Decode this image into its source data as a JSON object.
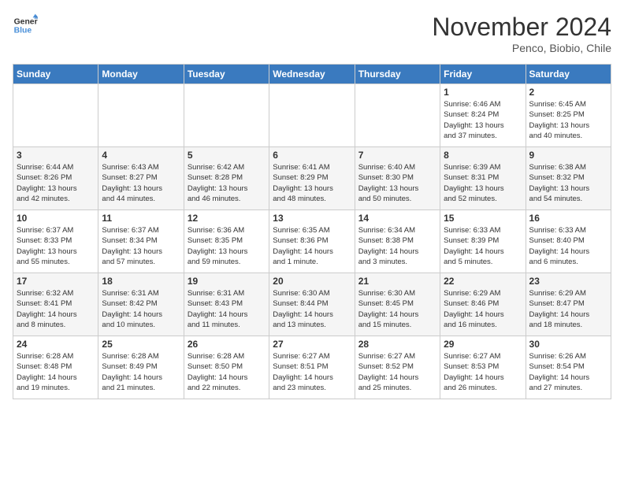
{
  "logo": {
    "line1": "General",
    "line2": "Blue"
  },
  "title": "November 2024",
  "subtitle": "Penco, Biobio, Chile",
  "days_of_week": [
    "Sunday",
    "Monday",
    "Tuesday",
    "Wednesday",
    "Thursday",
    "Friday",
    "Saturday"
  ],
  "weeks": [
    [
      {
        "day": "",
        "info": ""
      },
      {
        "day": "",
        "info": ""
      },
      {
        "day": "",
        "info": ""
      },
      {
        "day": "",
        "info": ""
      },
      {
        "day": "",
        "info": ""
      },
      {
        "day": "1",
        "info": "Sunrise: 6:46 AM\nSunset: 8:24 PM\nDaylight: 13 hours\nand 37 minutes."
      },
      {
        "day": "2",
        "info": "Sunrise: 6:45 AM\nSunset: 8:25 PM\nDaylight: 13 hours\nand 40 minutes."
      }
    ],
    [
      {
        "day": "3",
        "info": "Sunrise: 6:44 AM\nSunset: 8:26 PM\nDaylight: 13 hours\nand 42 minutes."
      },
      {
        "day": "4",
        "info": "Sunrise: 6:43 AM\nSunset: 8:27 PM\nDaylight: 13 hours\nand 44 minutes."
      },
      {
        "day": "5",
        "info": "Sunrise: 6:42 AM\nSunset: 8:28 PM\nDaylight: 13 hours\nand 46 minutes."
      },
      {
        "day": "6",
        "info": "Sunrise: 6:41 AM\nSunset: 8:29 PM\nDaylight: 13 hours\nand 48 minutes."
      },
      {
        "day": "7",
        "info": "Sunrise: 6:40 AM\nSunset: 8:30 PM\nDaylight: 13 hours\nand 50 minutes."
      },
      {
        "day": "8",
        "info": "Sunrise: 6:39 AM\nSunset: 8:31 PM\nDaylight: 13 hours\nand 52 minutes."
      },
      {
        "day": "9",
        "info": "Sunrise: 6:38 AM\nSunset: 8:32 PM\nDaylight: 13 hours\nand 54 minutes."
      }
    ],
    [
      {
        "day": "10",
        "info": "Sunrise: 6:37 AM\nSunset: 8:33 PM\nDaylight: 13 hours\nand 55 minutes."
      },
      {
        "day": "11",
        "info": "Sunrise: 6:37 AM\nSunset: 8:34 PM\nDaylight: 13 hours\nand 57 minutes."
      },
      {
        "day": "12",
        "info": "Sunrise: 6:36 AM\nSunset: 8:35 PM\nDaylight: 13 hours\nand 59 minutes."
      },
      {
        "day": "13",
        "info": "Sunrise: 6:35 AM\nSunset: 8:36 PM\nDaylight: 14 hours\nand 1 minute."
      },
      {
        "day": "14",
        "info": "Sunrise: 6:34 AM\nSunset: 8:38 PM\nDaylight: 14 hours\nand 3 minutes."
      },
      {
        "day": "15",
        "info": "Sunrise: 6:33 AM\nSunset: 8:39 PM\nDaylight: 14 hours\nand 5 minutes."
      },
      {
        "day": "16",
        "info": "Sunrise: 6:33 AM\nSunset: 8:40 PM\nDaylight: 14 hours\nand 6 minutes."
      }
    ],
    [
      {
        "day": "17",
        "info": "Sunrise: 6:32 AM\nSunset: 8:41 PM\nDaylight: 14 hours\nand 8 minutes."
      },
      {
        "day": "18",
        "info": "Sunrise: 6:31 AM\nSunset: 8:42 PM\nDaylight: 14 hours\nand 10 minutes."
      },
      {
        "day": "19",
        "info": "Sunrise: 6:31 AM\nSunset: 8:43 PM\nDaylight: 14 hours\nand 11 minutes."
      },
      {
        "day": "20",
        "info": "Sunrise: 6:30 AM\nSunset: 8:44 PM\nDaylight: 14 hours\nand 13 minutes."
      },
      {
        "day": "21",
        "info": "Sunrise: 6:30 AM\nSunset: 8:45 PM\nDaylight: 14 hours\nand 15 minutes."
      },
      {
        "day": "22",
        "info": "Sunrise: 6:29 AM\nSunset: 8:46 PM\nDaylight: 14 hours\nand 16 minutes."
      },
      {
        "day": "23",
        "info": "Sunrise: 6:29 AM\nSunset: 8:47 PM\nDaylight: 14 hours\nand 18 minutes."
      }
    ],
    [
      {
        "day": "24",
        "info": "Sunrise: 6:28 AM\nSunset: 8:48 PM\nDaylight: 14 hours\nand 19 minutes."
      },
      {
        "day": "25",
        "info": "Sunrise: 6:28 AM\nSunset: 8:49 PM\nDaylight: 14 hours\nand 21 minutes."
      },
      {
        "day": "26",
        "info": "Sunrise: 6:28 AM\nSunset: 8:50 PM\nDaylight: 14 hours\nand 22 minutes."
      },
      {
        "day": "27",
        "info": "Sunrise: 6:27 AM\nSunset: 8:51 PM\nDaylight: 14 hours\nand 23 minutes."
      },
      {
        "day": "28",
        "info": "Sunrise: 6:27 AM\nSunset: 8:52 PM\nDaylight: 14 hours\nand 25 minutes."
      },
      {
        "day": "29",
        "info": "Sunrise: 6:27 AM\nSunset: 8:53 PM\nDaylight: 14 hours\nand 26 minutes."
      },
      {
        "day": "30",
        "info": "Sunrise: 6:26 AM\nSunset: 8:54 PM\nDaylight: 14 hours\nand 27 minutes."
      }
    ]
  ]
}
